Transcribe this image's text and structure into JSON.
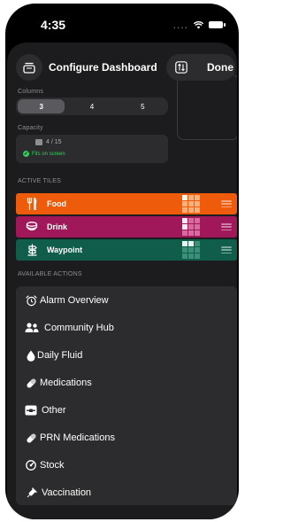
{
  "status_bar": {
    "time": "4:35",
    "signal": "...."
  },
  "header": {
    "title": "Configure Dashboard",
    "done_label": "Done"
  },
  "columns": {
    "label": "Columns",
    "options": [
      "3",
      "4",
      "5"
    ],
    "selected": "3"
  },
  "capacity": {
    "label": "Capacity",
    "value": "4 / 15",
    "status": "Fits on screen"
  },
  "active_tiles": {
    "label": "ACTIVE TILES",
    "items": [
      {
        "label": "Food",
        "color": "#ee5b0a",
        "icon": "fork-knife-icon"
      },
      {
        "label": "Drink",
        "color": "#a0175a",
        "icon": "cup-icon"
      },
      {
        "label": "Waypoint",
        "color": "#0f5d4a",
        "icon": "signpost-icon"
      }
    ]
  },
  "available_actions": {
    "label": "AVAILABLE ACTIONS",
    "items": [
      {
        "label": "Alarm Overview",
        "icon": "alarm-clock-icon"
      },
      {
        "label": "Community Hub",
        "icon": "people-icon"
      },
      {
        "label": "Daily Fluid",
        "icon": "drop-icon"
      },
      {
        "label": "Medications",
        "icon": "pill-icon"
      },
      {
        "label": "Other",
        "icon": "tray-icon"
      },
      {
        "label": "PRN Medications",
        "icon": "pill-icon"
      },
      {
        "label": "Stock",
        "icon": "gauge-icon"
      },
      {
        "label": "Vaccination",
        "icon": "syringe-icon"
      }
    ]
  }
}
